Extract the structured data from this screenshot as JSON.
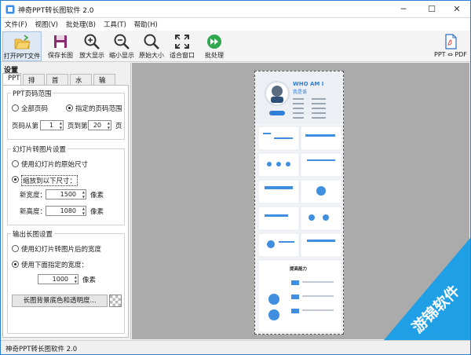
{
  "window": {
    "title": "神奇PPT转长图软件 2.0",
    "minimize": "─",
    "maximize": "☐",
    "close": "✕"
  },
  "menu": [
    "文件(F)",
    "视图(V)",
    "批处理(B)",
    "工具(T)",
    "帮助(H)"
  ],
  "toolbar": {
    "open": "打开PPT文件",
    "save": "保存长图",
    "zoom_in": "放大显示",
    "zoom_out": "缩小显示",
    "original": "原始大小",
    "fit": "适合窗口",
    "batch": "批处理",
    "ppt_pdf": "PPT ⇔ PDF"
  },
  "panel": {
    "title": "设置",
    "tabs": [
      "PPT",
      "排版",
      "首页",
      "水印",
      "输出"
    ]
  },
  "range": {
    "title": "PPT页码范围",
    "all": "全部页码",
    "specified": "指定的页码范围",
    "from_label": "页码从第",
    "from_value": "1",
    "to_label": "页到第",
    "to_value": "20",
    "unit": "页"
  },
  "slide": {
    "title": "幻灯片转图片设置",
    "original": "使用幻灯片的原始尺寸",
    "scale": "缩放到以下尺寸：",
    "width_label": "新宽度：",
    "width_value": "1500",
    "height_label": "新高度：",
    "height_value": "1080",
    "unit": "像素"
  },
  "output": {
    "title": "输出长图设置",
    "use_width": "使用幻灯片转图片后的宽度",
    "use_below": "使用下面指定的宽度：",
    "width_value": "1000",
    "unit": "像素",
    "bg_button": "长图背景底色和透明度..."
  },
  "preview": {
    "who": "WHO AM I",
    "name": "我是谁",
    "section": "提高能力"
  },
  "status": "神奇PPT转长图软件 2.0",
  "watermark": "游锦软件"
}
